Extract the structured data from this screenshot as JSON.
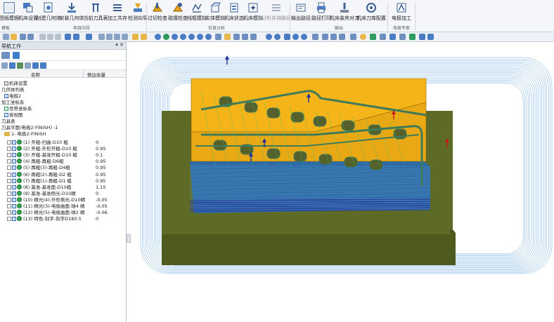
{
  "ribbon": {
    "buttons": [
      {
        "label": "图纸模板",
        "icon": "template-icon"
      },
      {
        "label": "机床设置",
        "icon": "machine-setup-icon"
      },
      {
        "label": "创建几何体",
        "icon": "create-geometry-icon"
      },
      {
        "label": "安装几何体",
        "icon": "install-geometry-icon"
      },
      {
        "label": "当前刀具表",
        "icon": "tool-table-icon"
      },
      {
        "label": "加工共存",
        "icon": "machining-coexist-icon"
      },
      {
        "label": "检测向导",
        "icon": "inspect-wizard-icon"
      },
      {
        "label": "过切检查",
        "icon": "gouge-check-icon"
      },
      {
        "label": "碰撞检查",
        "icon": "collision-check-icon"
      },
      {
        "label": "线框模拟",
        "icon": "wireframe-sim-icon"
      },
      {
        "label": "实体模拟",
        "icon": "solid-sim-icon"
      },
      {
        "label": "机床状态",
        "icon": "machine-state-icon"
      },
      {
        "label": "机床模拟",
        "icon": "machine-sim-icon"
      },
      {
        "label": "分析并排路径",
        "icon": "analyze-paths-icon"
      },
      {
        "label": "输出路径",
        "icon": "output-path-icon"
      },
      {
        "label": "路径打印",
        "icon": "path-print-icon"
      },
      {
        "label": "机床装夹对刀",
        "icon": "fixture-align-icon"
      },
      {
        "label": "机床刀库配置",
        "icon": "tool-magazine-icon"
      },
      {
        "label": "电极加工",
        "icon": "electrode-machining-icon"
      }
    ],
    "groups": [
      {
        "label": "模板"
      },
      {
        "label": "项目向导"
      },
      {
        "label": "仿真分析"
      },
      {
        "label": "输出"
      },
      {
        "label": "电极专家"
      }
    ]
  },
  "navigator": {
    "title": "导航工作",
    "controls": "▾ ✕",
    "columns": {
      "name": "名称",
      "stock": "侧边余量"
    },
    "tree": [
      {
        "label": "机床设置",
        "indent": 4,
        "icon": "machine-node-icon"
      },
      {
        "label": "几何体列表",
        "indent": 0,
        "icon": "none"
      },
      {
        "label": "电极2",
        "indent": 4,
        "icon": "electrode-node-icon"
      },
      {
        "label": "加工坐标系",
        "indent": 0,
        "icon": "none"
      },
      {
        "label": "世界坐标系",
        "indent": 4,
        "icon": "coordinate-icon"
      },
      {
        "label": "俯视图",
        "indent": 4,
        "icon": "view-icon"
      },
      {
        "label": "刀具表",
        "indent": 0,
        "icon": "none"
      },
      {
        "label": "刀具平面(电极2-FINISH) -1",
        "indent": 0,
        "icon": "none"
      },
      {
        "label": "1- 电极2-FINISH",
        "indent": 4,
        "icon": "folder-icon"
      }
    ],
    "operations": [
      {
        "label": "(1) 开粗-扫曲-D10 粗",
        "stock": "0"
      },
      {
        "label": "(2) 开粗-外形开粗-D10 粗",
        "stock": "0.95"
      },
      {
        "label": "(3) 开粗-基准开粗-D10 粗",
        "stock": "0.1"
      },
      {
        "label": "(4) 再粗-再粗-D6粗",
        "stock": "0.95"
      },
      {
        "label": "(5) 再粗(3)-再粗-D4粗",
        "stock": "0.95"
      },
      {
        "label": "(6) 再粗(2)-再粗-D2 粗",
        "stock": "0.95"
      },
      {
        "label": "(7) 再粗(1)-再粗-D1 粗",
        "stock": "0.95"
      },
      {
        "label": "(8) 基准-基准面-D10粗",
        "stock": "1.15"
      },
      {
        "label": "(9) 基准-基准侧光-D10精",
        "stock": "0"
      },
      {
        "label": "(10) 精光(4)-外形侧光-D10精",
        "stock": "-0.05"
      },
      {
        "label": "(11) 精光(3)-电极曲面-球4 精",
        "stock": "-0.05"
      },
      {
        "label": "(12) 精光(5)-电极曲面-球2 精",
        "stock": "-0.06"
      },
      {
        "label": "(13) 特色-刻字-刻字D180.5",
        "stock": "0"
      }
    ]
  },
  "colors": {
    "electrode_top": "#f5b417",
    "base_plate": "#5e6b26",
    "toolpath": "#3e8fd8",
    "finish_path": "#2c3f9e",
    "rib": "#3f7a5a"
  }
}
